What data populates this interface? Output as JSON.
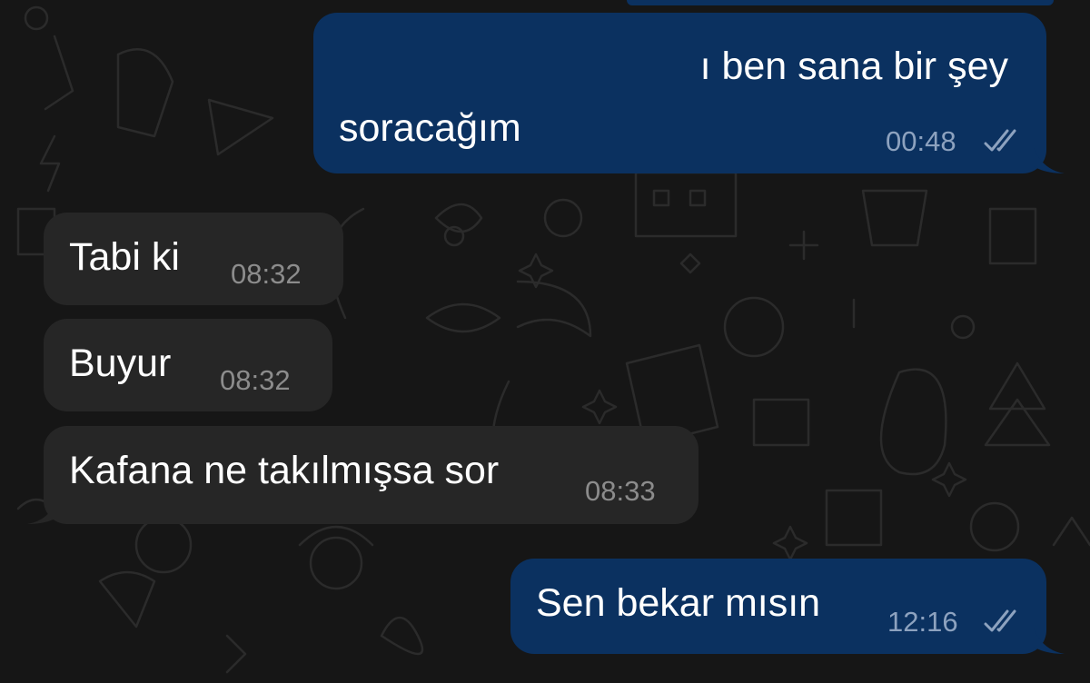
{
  "theme": {
    "outgoing_bubble": "#0b3160",
    "incoming_bubble": "#262626",
    "background": "#161616",
    "text": "#ffffff",
    "outgoing_time": "#8da2bf",
    "incoming_time": "#8c8c8c"
  },
  "messages": [
    {
      "direction": "outgoing",
      "lines": [
        "ı ben sana bir şey",
        "soracağım"
      ],
      "time": "00:48",
      "status": "read-double-check-icon"
    },
    {
      "direction": "incoming",
      "text": "Tabi ki",
      "time": "08:32"
    },
    {
      "direction": "incoming",
      "text": "Buyur",
      "time": "08:32"
    },
    {
      "direction": "incoming",
      "text": "Kafana ne takılmışsa sor",
      "time": "08:33"
    },
    {
      "direction": "outgoing",
      "text": "Sen bekar mısın",
      "time": "12:16",
      "status": "read-double-check-icon"
    }
  ]
}
